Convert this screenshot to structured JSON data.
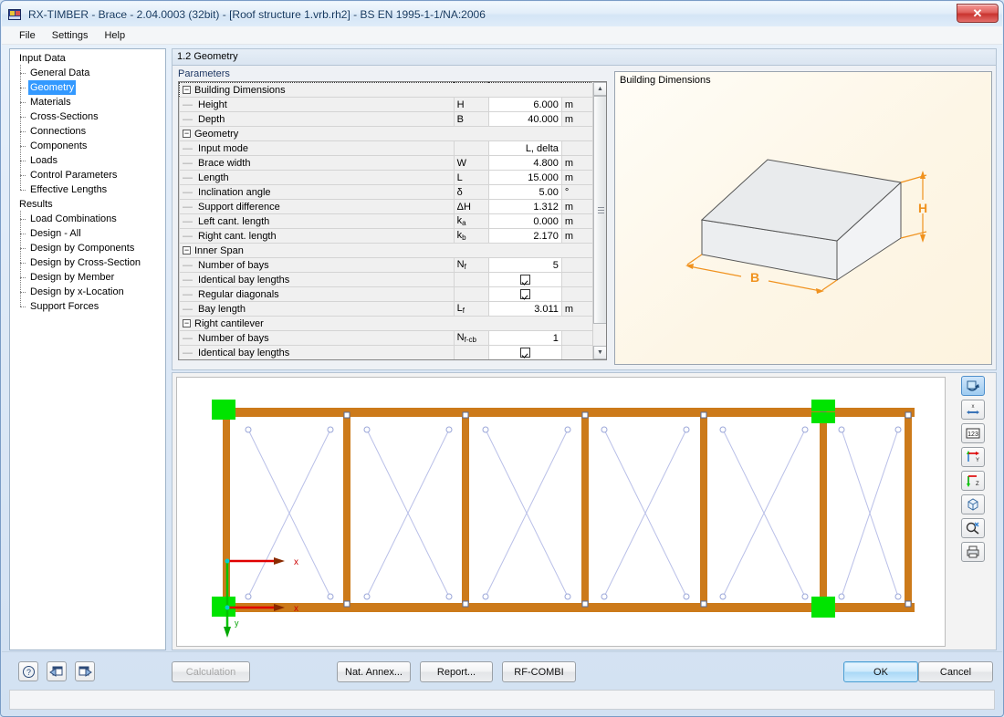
{
  "window": {
    "title": "RX-TIMBER - Brace - 2.04.0003 (32bit) - [Roof structure 1.vrb.rh2] - BS EN 1995-1-1/NA:2006",
    "close_label": "✕",
    "app_icon": "app-icon"
  },
  "menubar": {
    "items": [
      "File",
      "Settings",
      "Help"
    ]
  },
  "sidebar": {
    "groups": [
      {
        "label": "Input Data",
        "items": [
          "General Data",
          "Geometry",
          "Materials",
          "Cross-Sections",
          "Connections",
          "Components",
          "Loads",
          "Control Parameters",
          "Effective Lengths"
        ],
        "selected": "Geometry"
      },
      {
        "label": "Results",
        "items": [
          "Load Combinations",
          "Design - All",
          "Design by Components",
          "Design by Cross-Section",
          "Design by Member",
          "Design by x-Location",
          "Support Forces"
        ],
        "selected": ""
      }
    ]
  },
  "content": {
    "tab_title": "1.2 Geometry",
    "parameters_label": "Parameters",
    "picture_title": "Building Dimensions",
    "picture_labels": {
      "height": "H",
      "width": "B"
    },
    "grid": {
      "rows": [
        {
          "type": "group",
          "name": "Building Dimensions",
          "expander": "−"
        },
        {
          "type": "data",
          "name": "Height",
          "symbol": "H",
          "value": "6.000",
          "unit": "m"
        },
        {
          "type": "data",
          "name": "Depth",
          "symbol": "B",
          "value": "40.000",
          "unit": "m"
        },
        {
          "type": "group",
          "name": "Geometry",
          "expander": "−"
        },
        {
          "type": "data",
          "name": "Input mode",
          "symbol": "",
          "value": "L, delta",
          "unit": ""
        },
        {
          "type": "data",
          "name": "Brace width",
          "symbol": "W",
          "value": "4.800",
          "unit": "m"
        },
        {
          "type": "data",
          "name": "Length",
          "symbol": "L",
          "value": "15.000",
          "unit": "m"
        },
        {
          "type": "data",
          "name": "Inclination angle",
          "symbol": "δ",
          "value": "5.00",
          "unit": "°"
        },
        {
          "type": "data",
          "name": "Support difference",
          "symbol": "ΔH",
          "value": "1.312",
          "unit": "m"
        },
        {
          "type": "data",
          "name": "Left cant. length",
          "symbol": "k",
          "sub": "a",
          "value": "0.000",
          "unit": "m"
        },
        {
          "type": "data",
          "name": "Right cant. length",
          "symbol": "k",
          "sub": "b",
          "value": "2.170",
          "unit": "m"
        },
        {
          "type": "group",
          "name": "Inner Span",
          "expander": "−"
        },
        {
          "type": "data",
          "name": "Number of bays",
          "symbol": "N",
          "sub": "f",
          "value": "5",
          "unit": ""
        },
        {
          "type": "check",
          "name": "Identical bay lengths",
          "symbol": "",
          "checked": true,
          "unit": ""
        },
        {
          "type": "check",
          "name": "Regular diagonals",
          "symbol": "",
          "checked": true,
          "unit": ""
        },
        {
          "type": "data",
          "name": "Bay length",
          "symbol": "L",
          "sub": "f",
          "value": "3.011",
          "unit": "m"
        },
        {
          "type": "group",
          "name": "Right cantilever",
          "expander": "−"
        },
        {
          "type": "data",
          "name": "Number of bays",
          "symbol": "N",
          "sub": "f-cb",
          "value": "1",
          "unit": ""
        },
        {
          "type": "check",
          "name": "Identical bay lengths",
          "symbol": "",
          "checked": true,
          "unit": ""
        }
      ]
    },
    "drawing": {
      "axis_x_label": "x",
      "axis_y_label": "y",
      "num_columns": 8,
      "num_bays": 7,
      "member_color": "#cc7a1a",
      "diagonal_color": "#b9bfe8",
      "support_color": "#00e400",
      "axis_color": "#e00000"
    },
    "view_toolbar": [
      {
        "icon": "rotate-view-icon",
        "active": true
      },
      {
        "icon": "dimension-x-icon",
        "active": false
      },
      {
        "icon": "numbering-icon",
        "active": false
      },
      {
        "icon": "axis-y-icon",
        "active": false
      },
      {
        "icon": "axis-z-icon",
        "active": false
      },
      {
        "icon": "isometric-cube-icon",
        "active": false
      },
      {
        "icon": "zoom-reset-icon",
        "active": false
      },
      {
        "icon": "print-icon",
        "active": false
      }
    ]
  },
  "footer": {
    "icon_buttons": [
      {
        "icon": "help-icon"
      },
      {
        "icon": "previous-page-icon"
      },
      {
        "icon": "next-page-icon"
      }
    ],
    "calculation_label": "Calculation",
    "nat_annex_label": "Nat. Annex...",
    "report_label": "Report...",
    "rf_combi_label": "RF-COMBI",
    "ok_label": "OK",
    "cancel_label": "Cancel"
  }
}
